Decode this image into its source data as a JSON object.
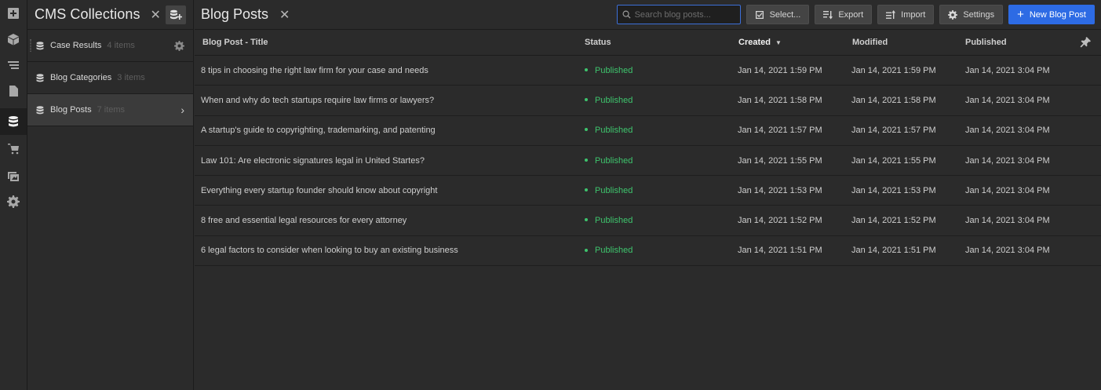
{
  "collections": {
    "title": "CMS Collections",
    "close_label": "✕",
    "items": [
      {
        "name": "Case Results",
        "count": "4 items"
      },
      {
        "name": "Blog Categories",
        "count": "3 items"
      },
      {
        "name": "Blog Posts",
        "count": "7 items"
      }
    ]
  },
  "main": {
    "title": "Blog Posts",
    "close_label": "✕",
    "search": {
      "placeholder": "Search blog posts..."
    },
    "buttons": {
      "select": "Select...",
      "export": "Export",
      "import": "Import",
      "settings": "Settings",
      "new": "New Blog Post"
    }
  },
  "table": {
    "headers": {
      "title": "Blog Post - Title",
      "status": "Status",
      "created": "Created",
      "modified": "Modified",
      "published": "Published"
    },
    "rows": [
      {
        "title": "8 tips in choosing the right law firm for your case and needs",
        "status": "Published",
        "created": "Jan 14, 2021 1:59 PM",
        "modified": "Jan 14, 2021 1:59 PM",
        "published": "Jan 14, 2021 3:04 PM"
      },
      {
        "title": "When and why do tech startups require law firms or lawyers?",
        "status": "Published",
        "created": "Jan 14, 2021 1:58 PM",
        "modified": "Jan 14, 2021 1:58 PM",
        "published": "Jan 14, 2021 3:04 PM"
      },
      {
        "title": "A startup's guide to copyrighting, trademarking, and patenting",
        "status": "Published",
        "created": "Jan 14, 2021 1:57 PM",
        "modified": "Jan 14, 2021 1:57 PM",
        "published": "Jan 14, 2021 3:04 PM"
      },
      {
        "title": "Law 101: Are electronic signatures legal in United Startes?",
        "status": "Published",
        "created": "Jan 14, 2021 1:55 PM",
        "modified": "Jan 14, 2021 1:55 PM",
        "published": "Jan 14, 2021 3:04 PM"
      },
      {
        "title": "Everything every startup founder should know about copyright",
        "status": "Published",
        "created": "Jan 14, 2021 1:53 PM",
        "modified": "Jan 14, 2021 1:53 PM",
        "published": "Jan 14, 2021 3:04 PM"
      },
      {
        "title": "8 free and essential legal resources for every attorney",
        "status": "Published",
        "created": "Jan 14, 2021 1:52 PM",
        "modified": "Jan 14, 2021 1:52 PM",
        "published": "Jan 14, 2021 3:04 PM"
      },
      {
        "title": "6 legal factors to consider when looking to buy an existing business",
        "status": "Published",
        "created": "Jan 14, 2021 1:51 PM",
        "modified": "Jan 14, 2021 1:51 PM",
        "published": "Jan 14, 2021 3:04 PM"
      }
    ]
  },
  "colors": {
    "accent": "#2d6be4",
    "status_published": "#3ec46d",
    "background": "#2b2b2b"
  },
  "icons": [
    "add-panel-icon",
    "cube-icon",
    "navigator-icon",
    "pages-icon",
    "cms-database-icon",
    "ecommerce-cart-icon",
    "assets-icon",
    "settings-gear-icon",
    "pin-icon",
    "search-icon",
    "checkbox-icon",
    "export-icon",
    "import-icon"
  ]
}
